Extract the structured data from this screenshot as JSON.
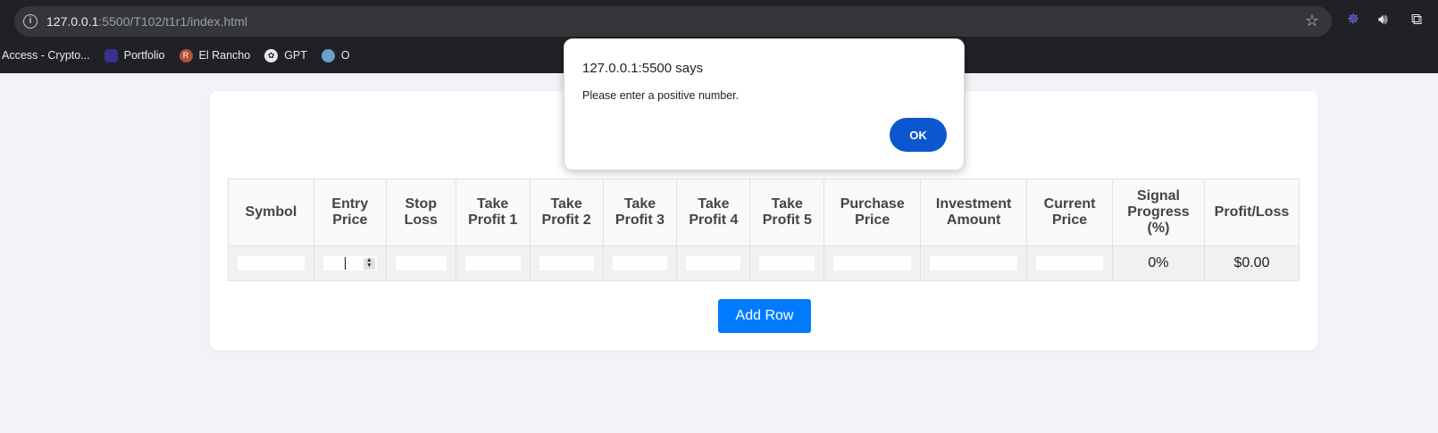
{
  "browser": {
    "url_host": "127.0.0.1",
    "url_rest": ":5500/T102/t1r1/index.html",
    "bookmarks": [
      {
        "label": "Access - Crypto..."
      },
      {
        "label": "Portfolio"
      },
      {
        "label": "El Rancho",
        "icon_letter": "R"
      },
      {
        "label": "GPT"
      },
      {
        "label": "O"
      }
    ]
  },
  "table": {
    "headers": [
      "Symbol",
      "Entry Price",
      "Stop Loss",
      "Take Profit 1",
      "Take Profit 2",
      "Take Profit 3",
      "Take Profit 4",
      "Take Profit 5",
      "Purchase Price",
      "Investment Amount",
      "Current Price",
      "Signal Progress (%)",
      "Profit/Loss"
    ],
    "row": {
      "signal_progress": "0%",
      "profit_loss": "$0.00"
    }
  },
  "add_row_label": "Add Row",
  "alert": {
    "title": "127.0.0.1:5500 says",
    "message": "Please enter a positive number.",
    "ok_label": "OK"
  },
  "colors": {
    "primary_button": "#007bff",
    "dialog_button": "#0b57d0",
    "chrome_bg": "#202124"
  }
}
